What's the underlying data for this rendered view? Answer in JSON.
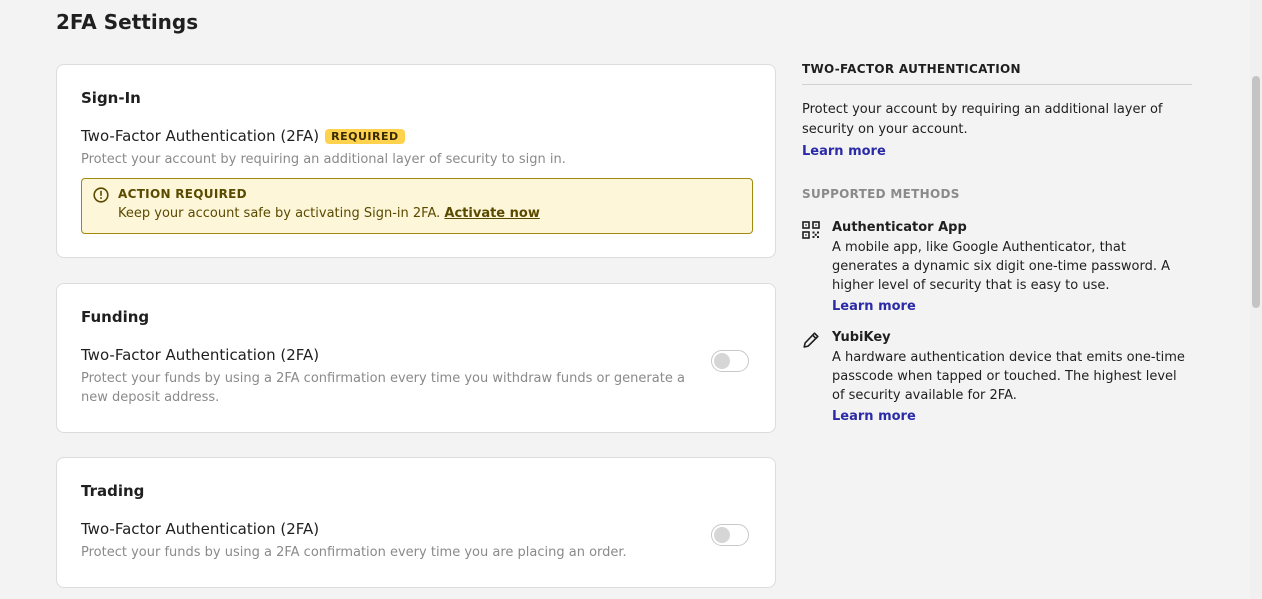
{
  "page": {
    "title": "2FA Settings"
  },
  "cards": {
    "signin": {
      "title": "Sign-In",
      "setting_title": "Two-Factor Authentication (2FA)",
      "badge": "REQUIRED",
      "desc": "Protect your account by requiring an additional layer of security to sign in.",
      "alert": {
        "title": "ACTION REQUIRED",
        "text": "Keep your account safe by activating Sign-in 2FA.",
        "link": "Activate now",
        "icon": "exclamation-circle-icon"
      }
    },
    "funding": {
      "title": "Funding",
      "setting_title": "Two-Factor Authentication (2FA)",
      "desc": "Protect your funds by using a 2FA confirmation every time you withdraw funds or generate a new deposit address.",
      "enabled": false
    },
    "trading": {
      "title": "Trading",
      "setting_title": "Two-Factor Authentication (2FA)",
      "desc": "Protect your funds by using a 2FA confirmation every time you are placing an order.",
      "enabled": false
    }
  },
  "sidebar": {
    "heading": "TWO-FACTOR AUTHENTICATION",
    "intro": "Protect your account by requiring an additional layer of security on your account.",
    "learn_more": "Learn more",
    "methods_heading": "SUPPORTED METHODS",
    "methods": [
      {
        "name": "Authenticator App",
        "icon": "qr-code-icon",
        "desc": "A mobile app, like Google Authenticator, that generates a dynamic six digit one-time password. A higher level of security that is easy to use.",
        "learn_more": "Learn more"
      },
      {
        "name": "YubiKey",
        "icon": "pen-key-icon",
        "desc": "A hardware authentication device that emits one-time passcode when tapped or touched. The highest level of security available for 2FA.",
        "learn_more": "Learn more"
      }
    ]
  },
  "colors": {
    "badge": "#ffd24d",
    "alert_bg": "#fdf6d8",
    "alert_border": "#a08a10",
    "link": "#2b2ba8",
    "page_bg": "#f3f3f3"
  }
}
